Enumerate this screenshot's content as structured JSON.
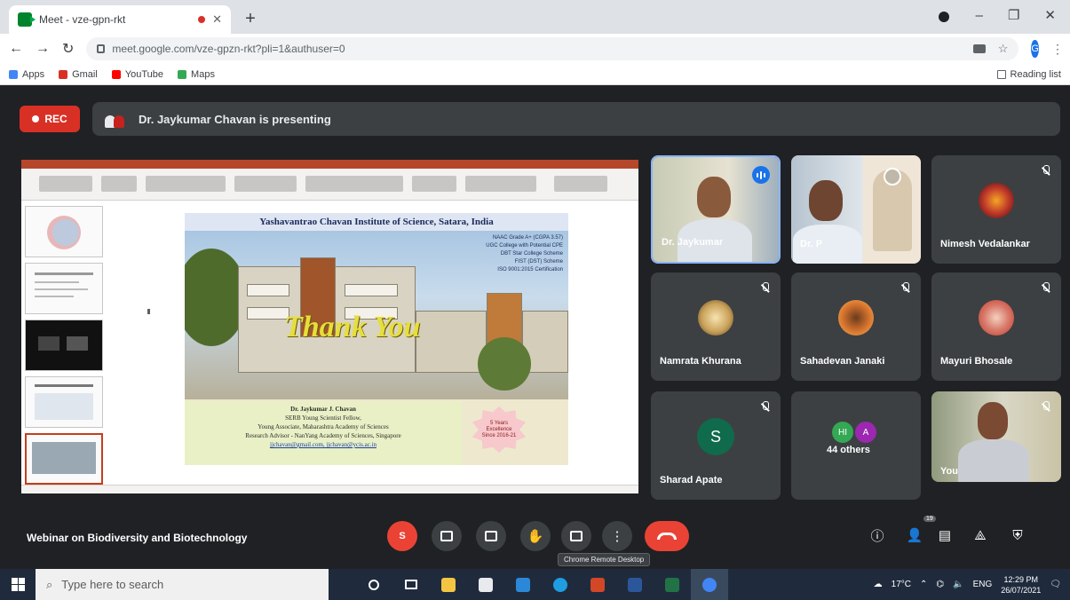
{
  "browser": {
    "tab_title": "Meet - vze-gpn-rkt",
    "new_tab": "+",
    "url": "meet.google.com/vze-gpzn-rkt?pli=1&authuser=0",
    "profile_initial": "G",
    "bookmarks": [
      "Apps",
      "Gmail",
      "YouTube",
      "Maps"
    ],
    "reading_list": "Reading list",
    "colors": {
      "gmail": "#d93025",
      "youtube": "#ff0000",
      "maps": "#34a853",
      "apps": "#4285f4"
    }
  },
  "meet": {
    "rec_label": "REC",
    "presenting_text": "Dr. Jaykumar Chavan is presenting",
    "meeting_title": "Webinar on Biodiversity and Biotechnology",
    "tooltip": "Chrome Remote Desktop",
    "people_count": "19",
    "self_initial": "S"
  },
  "slide": {
    "header": "Yashavantrao Chavan Institute of Science, Satara, India",
    "info_lines": [
      "NAAC Grade A+ (CGPA 3.57)",
      "UGC College with Potential CPE",
      "DBT Star College Scheme",
      "FIST (DST) Scheme",
      "ISO 9001:2015 Certification"
    ],
    "thank_you": "Thank You",
    "presenter": "Dr. Jaykumar J. Chavan",
    "roles": [
      "SERB Young Scientist Fellow,",
      "Young Associate, Maharashtra Academy of Sciences",
      "Research Advisor - NanYang Academy of Sciences, Singapore"
    ],
    "emails": "jjchavan@gmail.com, jjchavan@ycis.ac.in",
    "badge": "5 Years Excellence Since 2016-21"
  },
  "participants": [
    {
      "name": "Dr. Jaykumar",
      "camera": true,
      "speaking": true
    },
    {
      "name": "Dr. P",
      "camera": true,
      "speaking": false
    },
    {
      "name": "Nimesh Vedalankar",
      "camera": false,
      "muted": true
    },
    {
      "name": "Namrata Khurana",
      "camera": false,
      "muted": true
    },
    {
      "name": "Sahadevan Janaki",
      "camera": false,
      "muted": true
    },
    {
      "name": "Mayuri Bhosale",
      "camera": false,
      "muted": true
    },
    {
      "name": "Sharad Apate",
      "camera": false,
      "muted": true,
      "initial": "S"
    },
    {
      "name": "44 others",
      "camera": false,
      "initials": [
        "HI",
        "A"
      ]
    },
    {
      "name": "You",
      "camera": true,
      "muted": true
    }
  ],
  "taskbar": {
    "search_placeholder": "Type here to search",
    "weather": "17°C",
    "language": "ENG",
    "time": "12:29 PM",
    "date": "26/07/2021"
  }
}
